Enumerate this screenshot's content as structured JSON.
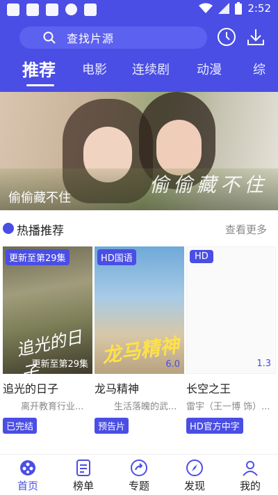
{
  "status_bar": {
    "time": "2:52",
    "left_icons": [
      "app-icon",
      "image-icon",
      "lock-icon",
      "shield-icon",
      "font-icon"
    ],
    "right_icons": [
      "wifi-icon",
      "signal-icon",
      "battery-icon"
    ]
  },
  "search": {
    "placeholder": "查找片源"
  },
  "header": {
    "history_icon": "clock-icon",
    "download_icon": "download-icon"
  },
  "tabs": [
    {
      "label": "推荐",
      "active": true
    },
    {
      "label": "电影",
      "active": false
    },
    {
      "label": "连续剧",
      "active": false
    },
    {
      "label": "动漫",
      "active": false
    },
    {
      "label": "综",
      "active": false
    }
  ],
  "banner": {
    "caption": "偷偷藏不住",
    "art_text": "偷偷藏不住"
  },
  "section": {
    "title": "热播推荐",
    "see_more": "查看更多"
  },
  "cards": [
    {
      "badge": "更新至第29集",
      "poster_bottom": "更新至第29集",
      "art_text": "追光的日子",
      "title": "追光的日子",
      "subtitle": "离开教育行业...",
      "tag": "已完结"
    },
    {
      "badge": "HD国语",
      "poster_bottom": "6.0",
      "art_text": "龙马精神",
      "title": "龙马精神",
      "subtitle": "生活落魄的武...",
      "tag": "预告片"
    },
    {
      "badge": "HD",
      "poster_bottom": "1.3",
      "art_text": "",
      "title": "长空之王",
      "subtitle": "雷宇（王一博 饰）...",
      "tag": "HD官方中字"
    }
  ],
  "bottom_nav": [
    {
      "label": "首页",
      "icon": "film-reel-icon",
      "active": true
    },
    {
      "label": "榜单",
      "icon": "list-icon",
      "active": false
    },
    {
      "label": "专题",
      "icon": "share-icon",
      "active": false
    },
    {
      "label": "发现",
      "icon": "compass-icon",
      "active": false
    },
    {
      "label": "我的",
      "icon": "user-icon",
      "active": false
    }
  ],
  "colors": {
    "brand": "#4a4ee4",
    "text": "#222222",
    "muted": "#888888"
  }
}
